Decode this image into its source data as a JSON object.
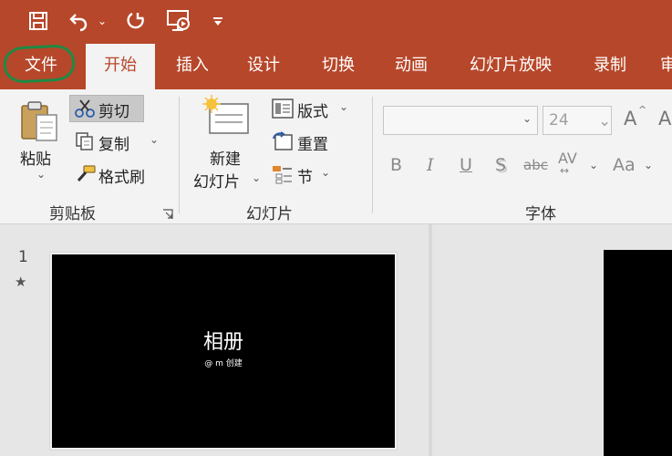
{
  "quick_access": {
    "icons": [
      "save-icon",
      "undo-icon",
      "redo-icon",
      "present-from-start-icon",
      "customize-icon"
    ]
  },
  "tabs": [
    "文件",
    "开始",
    "设计",
    "插入",
    "切换",
    "动画",
    "幻灯片放映",
    "录制",
    "审"
  ],
  "ribbon": {
    "clipboard": {
      "paste": "粘贴",
      "cut": "剪切",
      "copy": "复制",
      "format_painter": "格式刷",
      "group_label": "剪贴板"
    },
    "slides": {
      "new_slide_line1": "新建",
      "new_slide_line2": "幻灯片",
      "layout": "版式",
      "reset": "重置",
      "section": "节",
      "group_label": "幻灯片"
    },
    "font": {
      "font_name": "",
      "font_size": "24",
      "bold": "B",
      "italic": "I",
      "underline": "U",
      "shadow": "S",
      "strikethrough": "abc",
      "spacing": "AV",
      "change_case": "Aa",
      "grow": "A",
      "group_label": "字体"
    }
  },
  "slides_pane": {
    "slide_number": "1",
    "star": "★",
    "thumb_title": "相册",
    "thumb_subtitle": "@ m 创建"
  },
  "colors": {
    "titlebar": "#b7472a",
    "ribbon": "#f3f3f3",
    "annotation": "#1d8a45"
  }
}
